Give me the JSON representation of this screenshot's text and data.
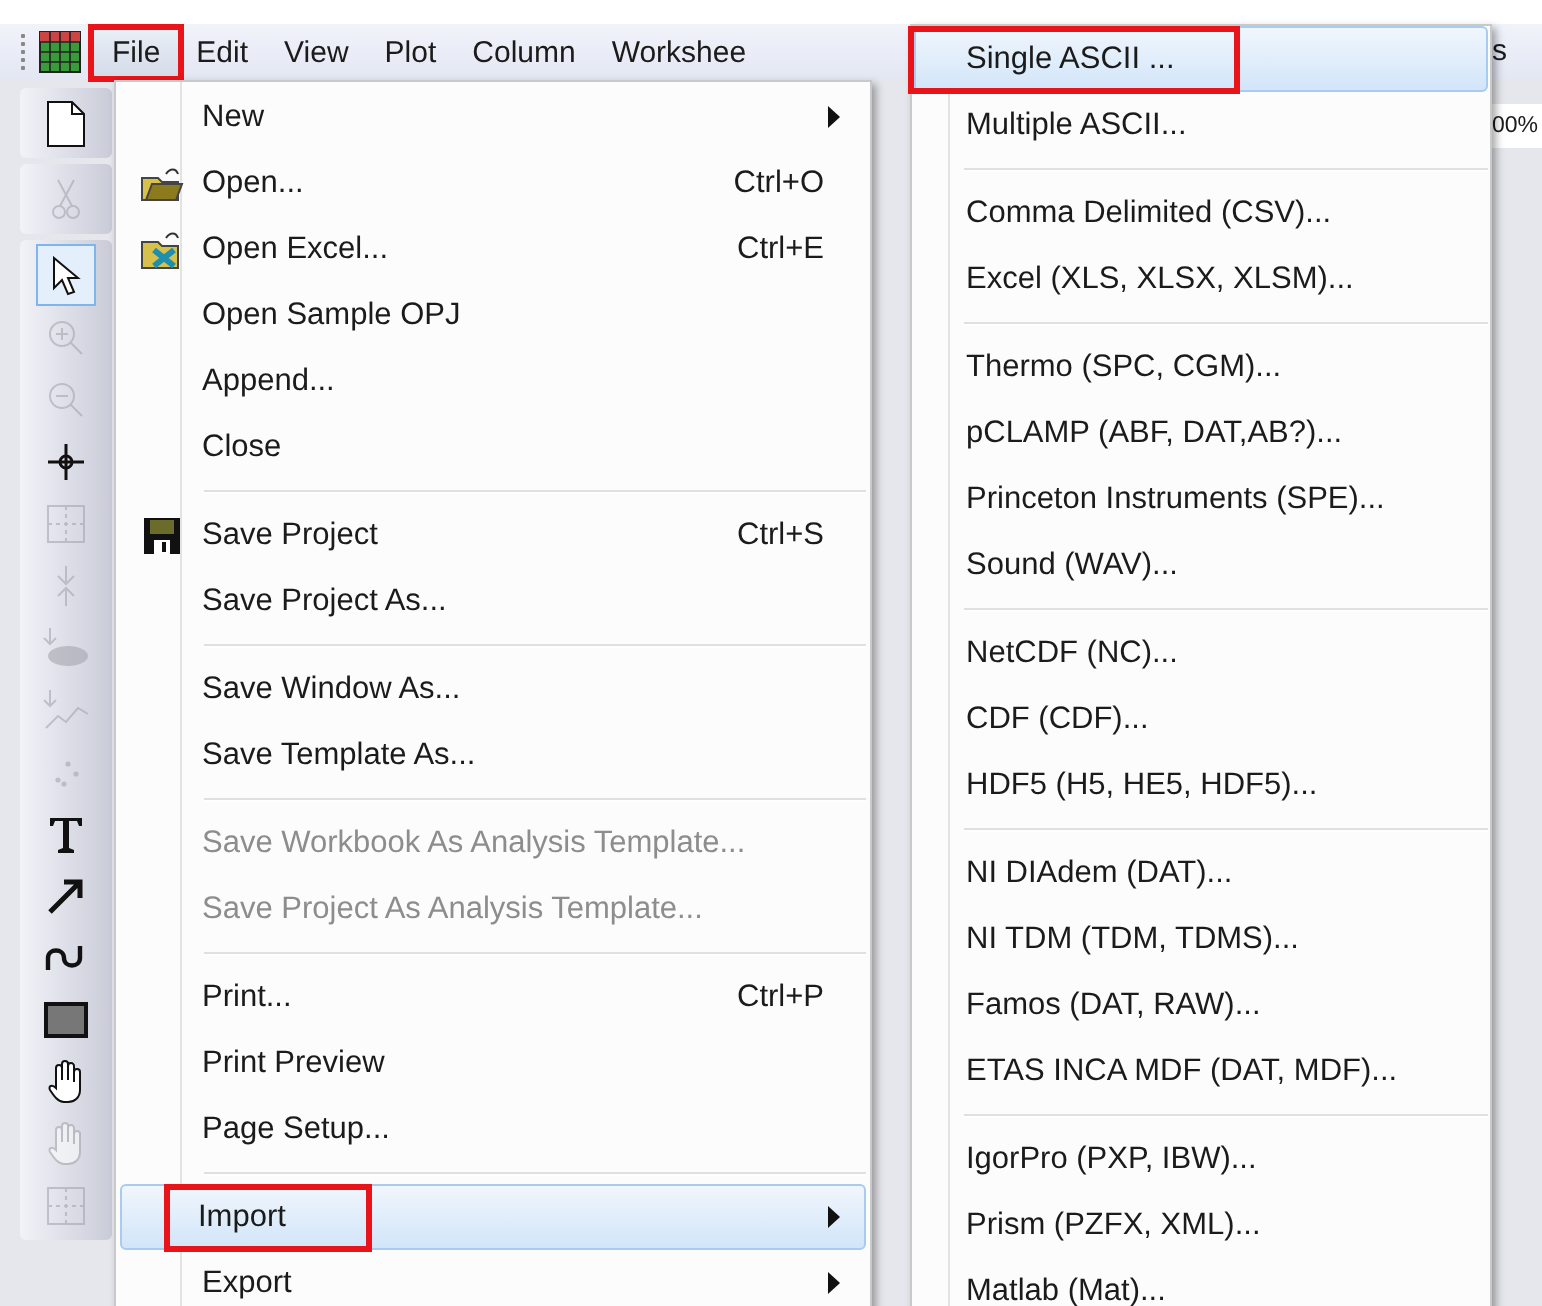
{
  "menubar": {
    "items": [
      {
        "label": "File",
        "selected": true,
        "annotated": true
      },
      {
        "label": "Edit",
        "selected": false,
        "annotated": false
      },
      {
        "label": "View",
        "selected": false,
        "annotated": false
      },
      {
        "label": "Plot",
        "selected": false,
        "annotated": false
      },
      {
        "label": "Column",
        "selected": false,
        "annotated": false
      },
      {
        "label": "Workshee",
        "selected": false,
        "annotated": false
      }
    ]
  },
  "right_edge": {
    "menu_fragment": "s",
    "zoom_field": "00%"
  },
  "toolbars": [
    {
      "tools": [
        {
          "kind": "new",
          "selected": false,
          "disabled": false
        }
      ]
    },
    {
      "tools": [
        {
          "kind": "cut",
          "selected": false,
          "disabled": true
        }
      ]
    },
    {
      "tools": [
        {
          "kind": "pointer",
          "selected": true,
          "disabled": false
        },
        {
          "kind": "zoom-in",
          "selected": false,
          "disabled": true
        },
        {
          "kind": "zoom-out",
          "selected": false,
          "disabled": true
        },
        {
          "kind": "crosshair",
          "selected": false,
          "disabled": false
        },
        {
          "kind": "region",
          "selected": false,
          "disabled": true
        },
        {
          "kind": "move",
          "selected": false,
          "disabled": true
        },
        {
          "kind": "mask",
          "selected": false,
          "disabled": true
        },
        {
          "kind": "draw-data",
          "selected": false,
          "disabled": true
        },
        {
          "kind": "dots",
          "selected": false,
          "disabled": true
        },
        {
          "kind": "text",
          "selected": false,
          "disabled": false
        },
        {
          "kind": "arrow",
          "selected": false,
          "disabled": false
        },
        {
          "kind": "curve",
          "selected": false,
          "disabled": false
        },
        {
          "kind": "rectangle",
          "selected": false,
          "disabled": false
        },
        {
          "kind": "hand",
          "selected": false,
          "disabled": false
        },
        {
          "kind": "hand",
          "selected": false,
          "disabled": true
        },
        {
          "kind": "region",
          "selected": false,
          "disabled": true
        }
      ]
    }
  ],
  "file_menu": {
    "groups": [
      [
        {
          "label": "New",
          "kind": "submenu",
          "selected": false,
          "disabled": false,
          "annotated": false
        },
        {
          "label": "Open...",
          "shortcut": "Ctrl+O",
          "kind": "item",
          "selected": false,
          "disabled": false,
          "annotated": false
        },
        {
          "label": "Open Excel...",
          "shortcut": "Ctrl+E",
          "kind": "item",
          "selected": false,
          "disabled": false,
          "annotated": false
        },
        {
          "label": "Open Sample OPJ",
          "kind": "item",
          "selected": false,
          "disabled": false,
          "annotated": false
        },
        {
          "label": "Append...",
          "kind": "item",
          "selected": false,
          "disabled": false,
          "annotated": false
        },
        {
          "label": "Close",
          "kind": "item",
          "selected": false,
          "disabled": false,
          "annotated": false
        }
      ],
      [
        {
          "label": "Save Project",
          "shortcut": "Ctrl+S",
          "kind": "item",
          "selected": false,
          "disabled": false,
          "annotated": false
        },
        {
          "label": "Save Project As...",
          "kind": "item",
          "selected": false,
          "disabled": false,
          "annotated": false
        }
      ],
      [
        {
          "label": "Save Window As...",
          "kind": "item",
          "selected": false,
          "disabled": false,
          "annotated": false
        },
        {
          "label": "Save Template As...",
          "kind": "item",
          "selected": false,
          "disabled": false,
          "annotated": false
        }
      ],
      [
        {
          "label": "Save Workbook As Analysis Template...",
          "kind": "item",
          "selected": false,
          "disabled": true,
          "annotated": false
        },
        {
          "label": "Save Project As Analysis Template...",
          "kind": "item",
          "selected": false,
          "disabled": true,
          "annotated": false
        }
      ],
      [
        {
          "label": "Print...",
          "shortcut": "Ctrl+P",
          "kind": "item",
          "selected": false,
          "disabled": false,
          "annotated": false
        },
        {
          "label": "Print Preview",
          "kind": "item",
          "selected": false,
          "disabled": false,
          "annotated": false
        },
        {
          "label": "Page Setup...",
          "kind": "item",
          "selected": false,
          "disabled": false,
          "annotated": false
        }
      ],
      [
        {
          "label": "Import",
          "kind": "submenu",
          "selected": true,
          "disabled": false,
          "annotated": true
        },
        {
          "label": "Export",
          "kind": "submenu",
          "selected": false,
          "disabled": false,
          "annotated": false
        }
      ]
    ]
  },
  "import_menu": {
    "groups": [
      [
        {
          "label": "Single ASCII ...",
          "kind": "item",
          "selected": true,
          "disabled": false,
          "annotated": true
        },
        {
          "label": "Multiple ASCII...",
          "kind": "item",
          "selected": false,
          "disabled": false,
          "annotated": false
        }
      ],
      [
        {
          "label": "Comma Delimited (CSV)...",
          "kind": "item",
          "selected": false,
          "disabled": false,
          "annotated": false
        },
        {
          "label": "Excel (XLS, XLSX, XLSM)...",
          "kind": "item",
          "selected": false,
          "disabled": false,
          "annotated": false
        }
      ],
      [
        {
          "label": "Thermo (SPC, CGM)...",
          "kind": "item",
          "selected": false,
          "disabled": false,
          "annotated": false
        },
        {
          "label": "pCLAMP (ABF, DAT,AB?)...",
          "kind": "item",
          "selected": false,
          "disabled": false,
          "annotated": false
        },
        {
          "label": "Princeton Instruments (SPE)...",
          "kind": "item",
          "selected": false,
          "disabled": false,
          "annotated": false
        },
        {
          "label": "Sound (WAV)...",
          "kind": "item",
          "selected": false,
          "disabled": false,
          "annotated": false
        }
      ],
      [
        {
          "label": "NetCDF (NC)...",
          "kind": "item",
          "selected": false,
          "disabled": false,
          "annotated": false
        },
        {
          "label": "CDF (CDF)...",
          "kind": "item",
          "selected": false,
          "disabled": false,
          "annotated": false
        },
        {
          "label": "HDF5 (H5, HE5, HDF5)...",
          "kind": "item",
          "selected": false,
          "disabled": false,
          "annotated": false
        }
      ],
      [
        {
          "label": "NI DIAdem (DAT)...",
          "kind": "item",
          "selected": false,
          "disabled": false,
          "annotated": false
        },
        {
          "label": "NI TDM (TDM, TDMS)...",
          "kind": "item",
          "selected": false,
          "disabled": false,
          "annotated": false
        },
        {
          "label": "Famos (DAT, RAW)...",
          "kind": "item",
          "selected": false,
          "disabled": false,
          "annotated": false
        },
        {
          "label": "ETAS INCA MDF (DAT, MDF)...",
          "kind": "item",
          "selected": false,
          "disabled": false,
          "annotated": false
        }
      ],
      [
        {
          "label": "IgorPro (PXP, IBW)...",
          "kind": "item",
          "selected": false,
          "disabled": false,
          "annotated": false
        },
        {
          "label": "Prism (PZFX, XML)...",
          "kind": "item",
          "selected": false,
          "disabled": false,
          "annotated": false
        },
        {
          "label": "Matlab (Mat)...",
          "kind": "item",
          "selected": false,
          "disabled": false,
          "annotated": false
        }
      ]
    ]
  }
}
